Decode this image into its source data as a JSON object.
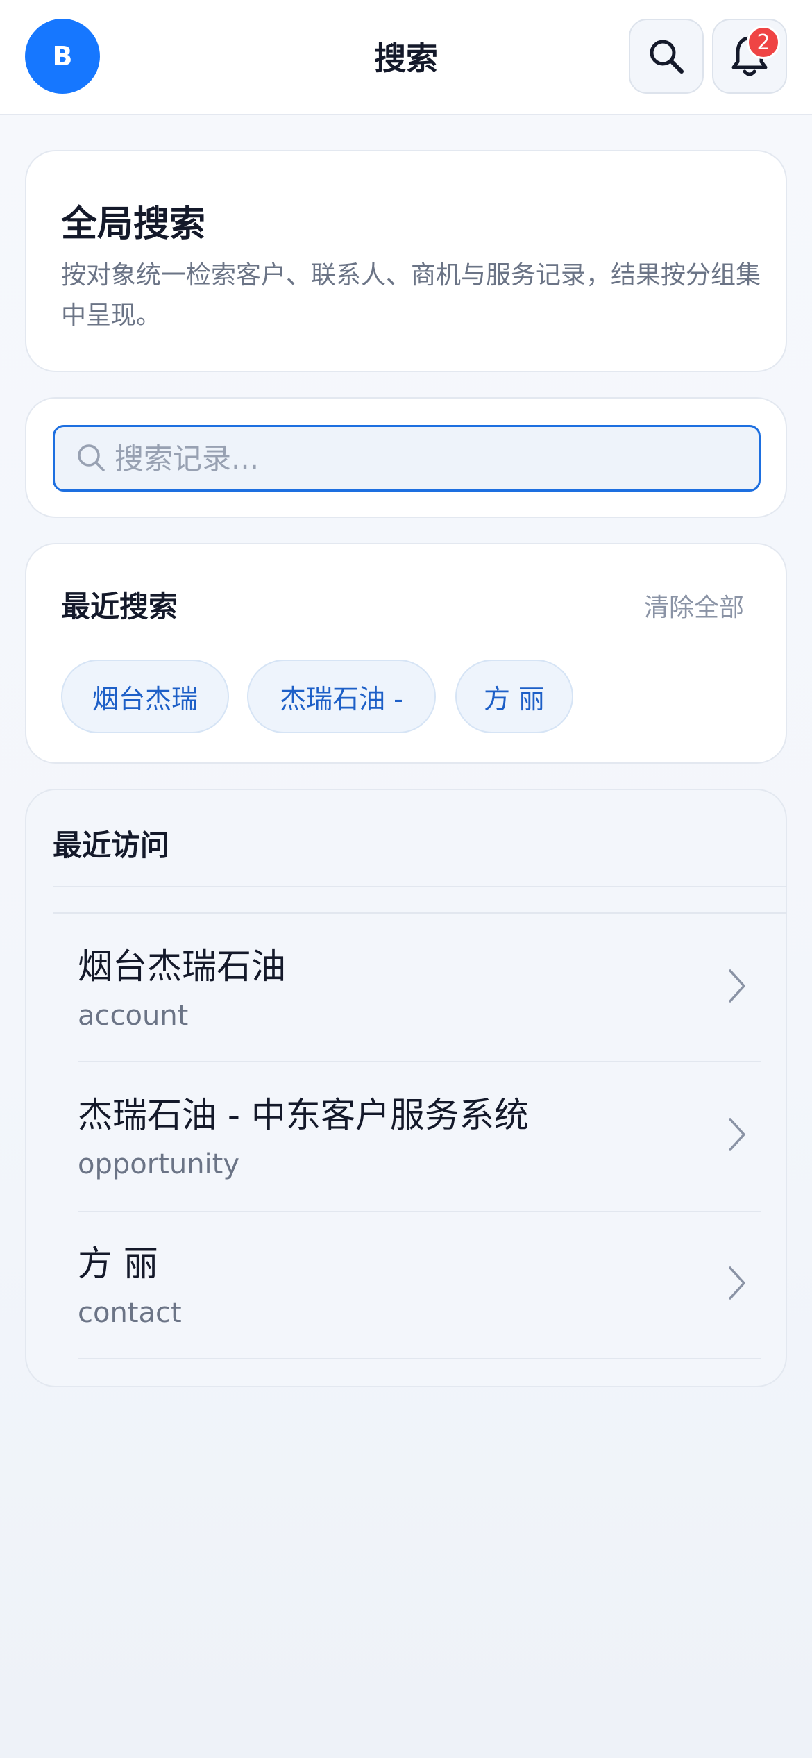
{
  "header": {
    "avatar_letter": "B",
    "title": "搜索",
    "notification_count": "2"
  },
  "intro": {
    "title": "全局搜索",
    "description": "按对象统一检索客户、联系人、商机与服务记录，结果按分组集中呈现。"
  },
  "search": {
    "placeholder": "搜索记录...",
    "value": ""
  },
  "recent_searches": {
    "title": "最近搜索",
    "clear_label": "清除全部",
    "chips": [
      "烟台杰瑞",
      "杰瑞石油 -",
      "方 丽"
    ]
  },
  "recent_visits": {
    "title": "最近访问",
    "items": [
      {
        "name": "烟台杰瑞石油",
        "type": "account"
      },
      {
        "name": "杰瑞石油 - 中东客户服务系统",
        "type": "opportunity"
      },
      {
        "name": "方 丽",
        "type": "contact"
      }
    ]
  },
  "colors": {
    "accent": "#1677ff",
    "badge": "#ef4444",
    "chip_text": "#1d5fc7"
  }
}
